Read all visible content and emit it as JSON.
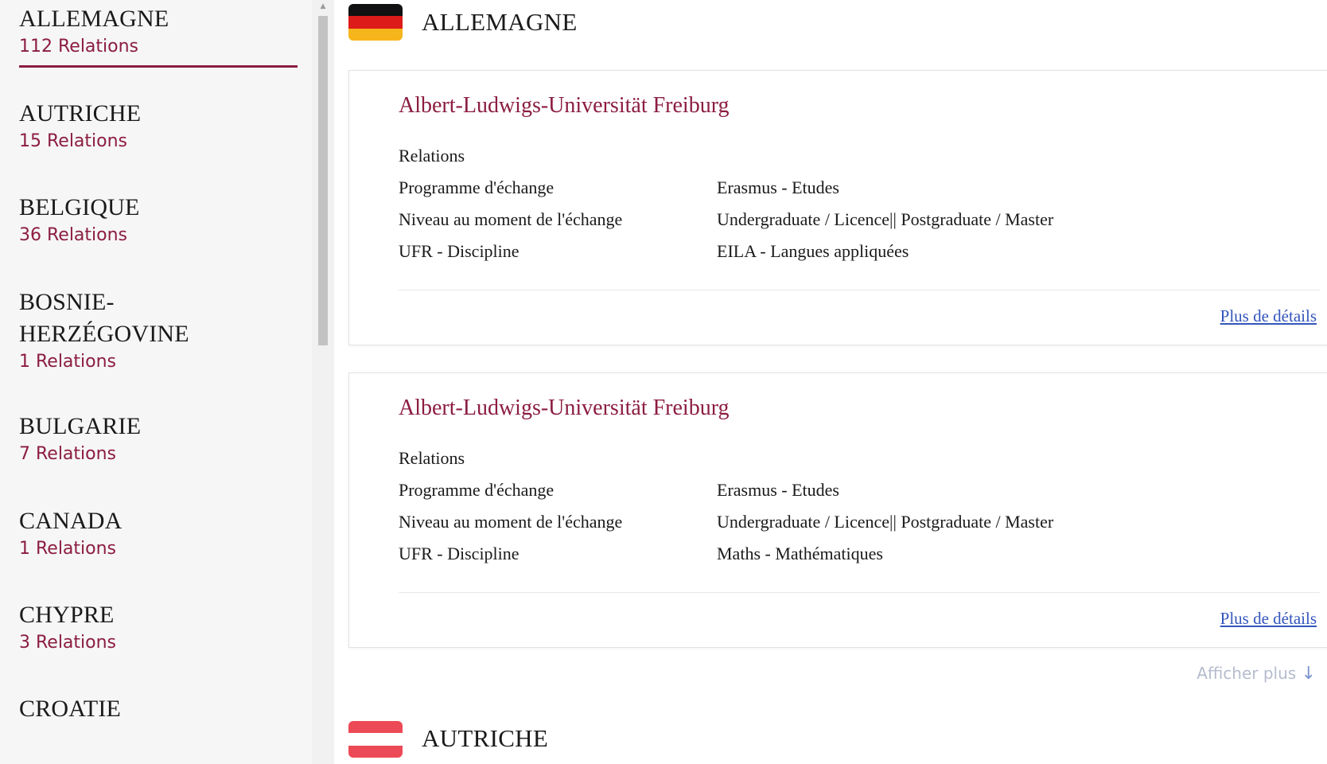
{
  "sidebar": {
    "countries": [
      {
        "name": "ALLEMAGNE",
        "relations": "112 Relations",
        "active": true
      },
      {
        "name": "AUTRICHE",
        "relations": "15 Relations"
      },
      {
        "name": "BELGIQUE",
        "relations": "36 Relations"
      },
      {
        "name": "BOSNIE-",
        "name2": "HERZÉGOVINE",
        "relations": "1 Relations"
      },
      {
        "name": "BULGARIE",
        "relations": "7 Relations"
      },
      {
        "name": "CANADA",
        "relations": "1 Relations"
      },
      {
        "name": "CHYPRE",
        "relations": "3 Relations"
      },
      {
        "name": "CROATIE"
      }
    ]
  },
  "main": {
    "sections": [
      {
        "country": "ALLEMAGNE",
        "flag_colors": [
          "#000000",
          "#dd0000",
          "#ffcc00"
        ]
      },
      {
        "country": "AUTRICHE",
        "flag_colors": [
          "#ed2939",
          "#ffffff",
          "#ed2939"
        ]
      }
    ],
    "cards": [
      {
        "title": "Albert-Ludwigs-Universität Freiburg",
        "subheading": "Relations",
        "rows": [
          {
            "label": "Programme d'échange",
            "value": "Erasmus - Etudes"
          },
          {
            "label": "Niveau au moment de l'échange",
            "value": "Undergraduate / Licence|| Postgraduate / Master"
          },
          {
            "label": "UFR - Discipline",
            "value": "EILA - Langues appliquées"
          }
        ],
        "details_link": "Plus de détails"
      },
      {
        "title": "Albert-Ludwigs-Universität Freiburg",
        "subheading": "Relations",
        "rows": [
          {
            "label": "Programme d'échange",
            "value": "Erasmus - Etudes"
          },
          {
            "label": "Niveau au moment de l'échange",
            "value": "Undergraduate / Licence|| Postgraduate / Master"
          },
          {
            "label": "UFR - Discipline",
            "value": "Maths - Mathématiques"
          }
        ],
        "details_link": "Plus de détails"
      }
    ],
    "show_more": "Afficher plus",
    "show_more_icon": "arrow-down-icon"
  },
  "colors": {
    "accent": "#8c1d40",
    "link": "#3355bb",
    "sidebar_bg": "#f6f6f6"
  }
}
